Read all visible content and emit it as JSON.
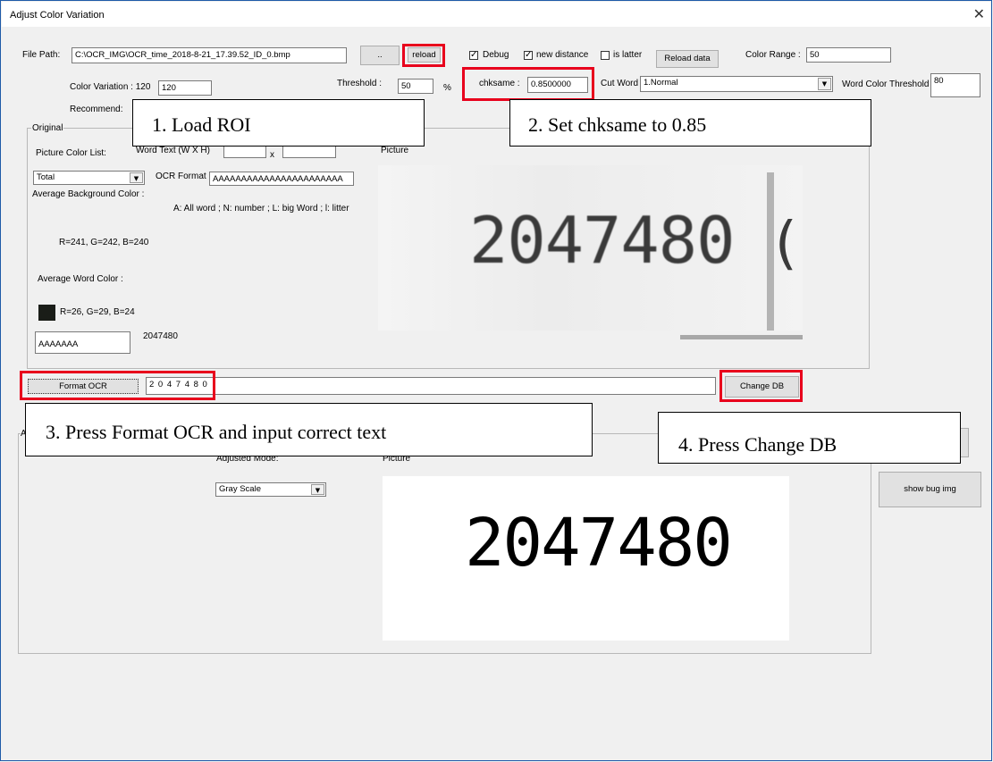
{
  "window": {
    "title": "Adjust Color Variation",
    "close_glyph": "✕"
  },
  "file": {
    "label": "File Path:",
    "value": "C:\\OCR_IMG\\OCR_time_2018-8-21_17.39.52_ID_0.bmp",
    "browse_label": "..",
    "reload_label": "reload"
  },
  "options": {
    "debug_label": "Debug",
    "debug_checked": true,
    "new_distance_label": "new distance",
    "new_distance_checked": true,
    "is_latter_label": "is latter",
    "is_latter_checked": false,
    "reload_data_label": "Reload data",
    "check_glyph": "✓"
  },
  "color_range": {
    "label": "Color Range :",
    "value": "50"
  },
  "color_variation": {
    "label": "Color Variation : 120",
    "value": "120"
  },
  "threshold": {
    "label": "Threshold :",
    "value": "50",
    "unit": "%"
  },
  "chksame": {
    "label": "chksame :",
    "value": "0.8500000"
  },
  "cut_word": {
    "label": "Cut Word",
    "value": "1.Normal"
  },
  "word_color_threshold": {
    "label": "Word Color Threshold :",
    "value": "80"
  },
  "recommend": {
    "label": "Recommend:"
  },
  "original": {
    "group_label": "Original",
    "picture_color_list_label": "Picture Color List:",
    "word_text_label": "Word Text (W X H)",
    "x_label": "x",
    "picture_label": "Picture",
    "color_list_value": "Total",
    "ocr_format_label": "OCR Format",
    "ocr_format_value": "AAAAAAAAAAAAAAAAAAAAAAA",
    "format_legend": "A: All word ; N: number ; L: big Word ; l: litter",
    "avg_bg_label": "Average Background Color :",
    "avg_bg_value": "R=241, G=242, B=240",
    "avg_word_label": "Average Word Color :",
    "avg_word_value": "R=26, G=29, B=24",
    "word_swatch_color": "#1a1d18",
    "result_box_value": "AAAAAAA",
    "result_text": "2047480",
    "image_text": "2047480",
    "image_trailing": "("
  },
  "format_ocr": {
    "button_label": "Format OCR",
    "value": "2 0 4 7 4 8 0",
    "change_db_label": "Change DB"
  },
  "adjusted": {
    "group_label": "A",
    "mode_label": "Adjusted Mode:",
    "picture_label": "Picture",
    "mode_value": "Gray Scale",
    "image_text": "2047480",
    "show_bug_label": "show bug img"
  },
  "callouts": {
    "step1": "1.   Load ROI",
    "step2": "2. Set chksame to 0.85",
    "step3": "3. Press Format OCR and input correct text",
    "step4": "4. Press Change DB"
  },
  "colors": {
    "highlight": "#e8001c",
    "window_border": "#1e5aa8"
  }
}
